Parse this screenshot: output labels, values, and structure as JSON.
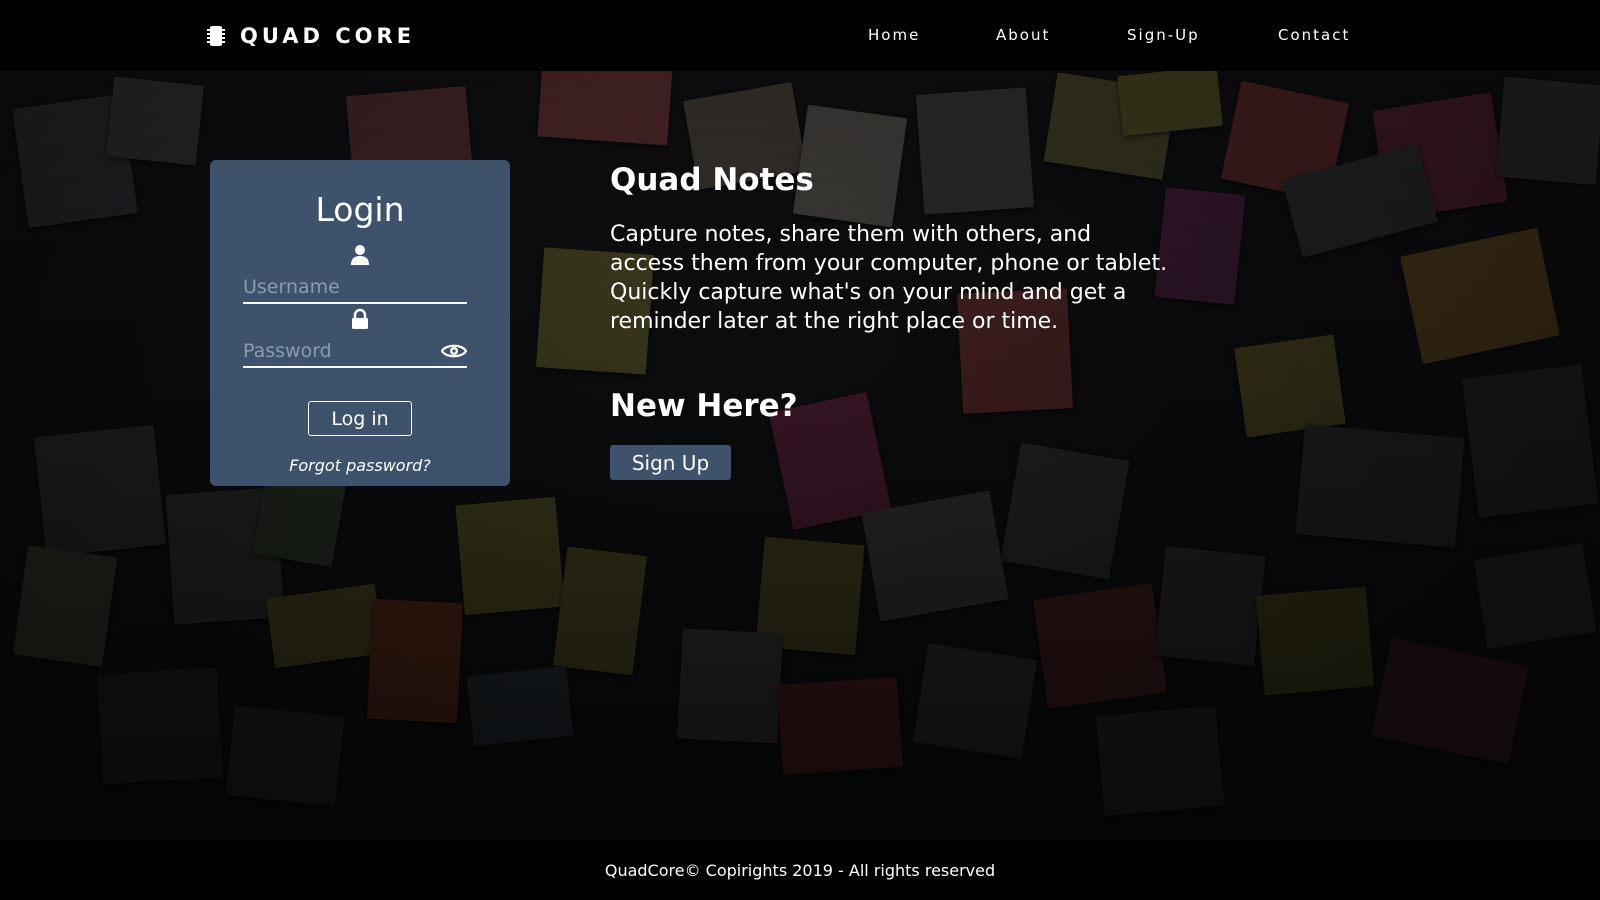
{
  "header": {
    "brand_icon": "chip-icon",
    "brand_name": "QUAD CORE",
    "nav": [
      {
        "label": "Home"
      },
      {
        "label": "About"
      },
      {
        "label": "Sign-Up"
      },
      {
        "label": "Contact"
      }
    ]
  },
  "login": {
    "title": "Login",
    "user_icon": "user-icon",
    "username_placeholder": "Username",
    "lock_icon": "lock-icon",
    "password_placeholder": "Password",
    "eye_icon": "eye-icon",
    "submit_label": "Log in",
    "forgot_label": "Forgot password?"
  },
  "hero": {
    "title": "Quad Notes",
    "description": "Capture notes, share them with others, and access them from your computer, phone or tablet. Quickly capture what's on your mind and get a reminder later at the right place or time.",
    "new_title": "New Here?",
    "signup_label": "Sign Up"
  },
  "footer": {
    "text": "QuadCore© Copirights 2019 - All rights reserved"
  },
  "colors": {
    "header_bg": "#000000",
    "card_bg": "#3e536b",
    "button_bg": "#3e536b",
    "text": "#ffffff"
  }
}
